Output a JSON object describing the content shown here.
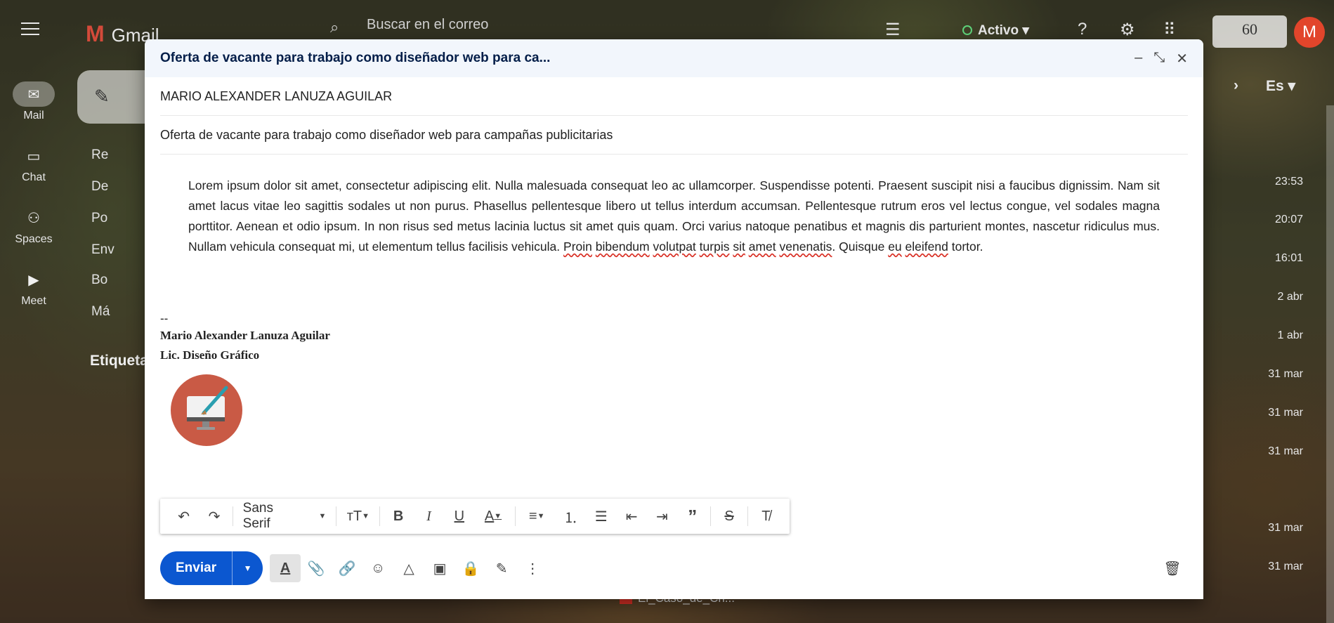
{
  "gmail": {
    "app_name": "Gmail",
    "search_placeholder": "Buscar en el correo",
    "status": "Activo",
    "brand_text": "60",
    "avatar_letter": "M",
    "compose_label": "Re",
    "nav_items": [
      "Re",
      "De",
      "Po",
      "Env",
      "Bo",
      "Má"
    ],
    "labels_heading": "Etiqueta",
    "lang": "Es",
    "times": [
      "23:53",
      "20:07",
      "16:01",
      "2 abr",
      "1 abr",
      "31 mar",
      "31 mar",
      "31 mar",
      "31 mar",
      "31 mar"
    ],
    "bottom_file": "El_Caso_de_Cri..."
  },
  "rail": {
    "mail": "Mail",
    "chat": "Chat",
    "spaces": "Spaces",
    "meet": "Meet"
  },
  "compose": {
    "title": "Oferta de vacante para trabajo como diseñador web para ca...",
    "to": "MARIO ALEXANDER LANUZA AGUILAR",
    "subject": "Oferta de vacante para trabajo como diseñador web para campañas publicitarias",
    "body_plain": "Lorem ipsum dolor sit amet, consectetur adipiscing elit. Nulla malesuada consequat leo ac ullamcorper. Suspendisse potenti. Praesent suscipit nisi a faucibus dignissim. Nam sit amet lacus vitae leo sagittis sodales ut non purus. Phasellus pellentesque libero ut tellus interdum accumsan. Pellentesque rutrum eros vel lectus congue, vel sodales magna porttitor. Aenean et odio ipsum. In non risus sed metus lacinia luctus sit amet quis quam. Orci varius natoque penatibus et magnis dis parturient montes, nascetur ridiculus mus. Nullam vehicula consequat mi, ut elementum tellus facilisis vehicula.",
    "body_spell": [
      "Proin",
      "bibendum",
      "volutpat",
      "turpis",
      "sit",
      "amet",
      "venenatis"
    ],
    "body_tail_1": ". Quisque ",
    "body_spell_2": [
      "eu",
      "eleifend"
    ],
    "body_tail_2": "tortor.",
    "sig_dash": "--",
    "sig_name": "Mario Alexander Lanuza Aguilar",
    "sig_title": "Lic. Diseño Gráfico",
    "font": "Sans Serif",
    "send_label": "Enviar"
  },
  "colors": {
    "send": "#0b57d0",
    "titlebar": "#f2f6fc",
    "avatar": "#e2452b",
    "sig_logo": "#c95a45"
  }
}
